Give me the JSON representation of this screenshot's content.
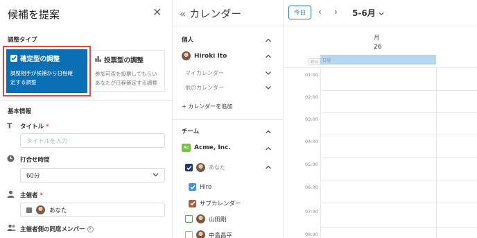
{
  "left_panel": {
    "title": "候補を提案",
    "adjust_type_label": "調整タイプ",
    "type_cards": [
      {
        "title": "確定型の調整",
        "desc_line1": "調整相手が候補から日程確",
        "desc_line2": "定する調整"
      },
      {
        "title": "投票型の調整",
        "desc_line1": "参加可否を投票してもらい",
        "desc_line2": "あなたが日程確定する調整"
      }
    ],
    "basic_info_label": "基本情報",
    "title_field": {
      "label": "タイトル",
      "required": "*",
      "placeholder": "タイトルを入力"
    },
    "duration_field": {
      "label": "打合せ時間",
      "value": "60分"
    },
    "host_field": {
      "label": "主催者",
      "required": "*",
      "value": "あなた"
    },
    "members_field": {
      "label": "主催者側の同席メンバー",
      "help": "?"
    }
  },
  "middle_panel": {
    "title": "カレンダー",
    "personal_label": "個人",
    "user_name": "Hiroki Ito",
    "my_calendar": "マイカレンダー",
    "other_calendar": "他のカレンダー",
    "add_calendar": "+ カレンダーを追加",
    "team_label": "チーム",
    "team_badge": "Ac",
    "team_name": "Acme, Inc.",
    "you_label": "あなた",
    "cal_hiro": "Hiro",
    "cal_sub": "サブカレンダー",
    "member1": "山田剛",
    "member2": "中島昌平"
  },
  "calendar": {
    "today_label": "今日",
    "month_label": "5-6月",
    "day_name": "月",
    "day_number": "26",
    "allday_label": "終日",
    "allday_event": "日曜",
    "hours": [
      "01:00",
      "02:00",
      "03:00",
      "04:00",
      "05:00",
      "06:00",
      "07:00",
      "08:00"
    ]
  },
  "colors": {
    "accent_blue": "#0a6fb5",
    "highlight_red": "#e04848",
    "hiro_checkbox": "#4a90d9",
    "sub_checkbox": "#a0624a",
    "yamada_checkbox": "#4caf50",
    "nakajima_checkbox": "#f0a030",
    "allday_event_bg": "#b6d7f2",
    "team_badge_bg": "#7bbf4a"
  }
}
